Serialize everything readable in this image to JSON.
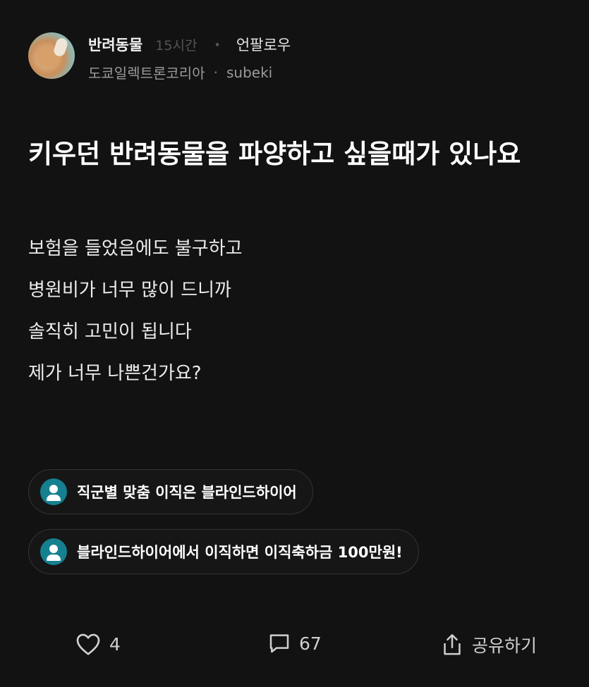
{
  "header": {
    "category": "반려동물",
    "time": "15시간",
    "separator": "•",
    "unfollow_label": "언팔로우",
    "company": "도쿄일렉트론코리아",
    "company_separator": "·",
    "username": "subeki",
    "avatar_icon": "cat-avatar"
  },
  "post": {
    "title": "키우던 반려동물을 파양하고 싶을때가 있나요",
    "body_lines": [
      "보험을 들었음에도 불구하고",
      "병원비가 너무 많이 드니까",
      "솔직히 고민이 됩니다",
      "제가 너무 나쁜건가요?"
    ]
  },
  "promos": [
    {
      "text": "직군별 맞춤 이직은 블라인드하이어",
      "icon": "person-icon"
    },
    {
      "text": "블라인드하이어에서 이직하면 이직축하금 100만원!",
      "icon": "person-icon"
    }
  ],
  "actions": {
    "like_count": "4",
    "comment_count": "67",
    "share_label": "공유하기"
  },
  "colors": {
    "background": "#121212",
    "accent_icon": "#148090",
    "muted_text": "#9a9a9a"
  }
}
